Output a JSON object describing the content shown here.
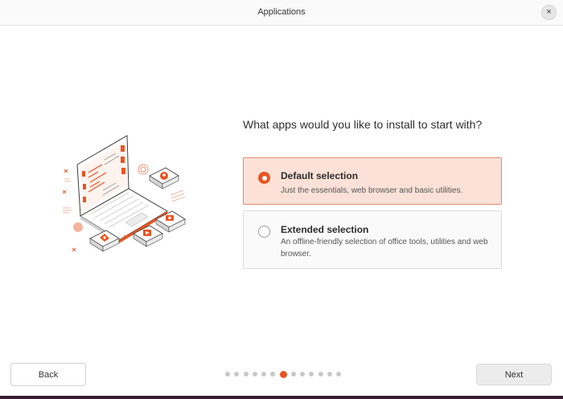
{
  "window": {
    "title": "Applications",
    "close_glyph": "×"
  },
  "main": {
    "question": "What apps would you like to install to start with?",
    "options": [
      {
        "title": "Default selection",
        "description": "Just the essentials, web browser and basic utilities.",
        "selected": true
      },
      {
        "title": "Extended selection",
        "description": "An offline-friendly selection of office tools, utilities and web browser.",
        "selected": false
      }
    ]
  },
  "footer": {
    "back_label": "Back",
    "next_label": "Next",
    "pager": {
      "total": 13,
      "current": 7
    }
  },
  "colors": {
    "accent": "#e95420",
    "selected_bg": "#fbe1d7",
    "selected_border": "#e68a6a"
  },
  "icons": {
    "close": "close-icon",
    "illustration": "laptop-apps-illustration"
  }
}
